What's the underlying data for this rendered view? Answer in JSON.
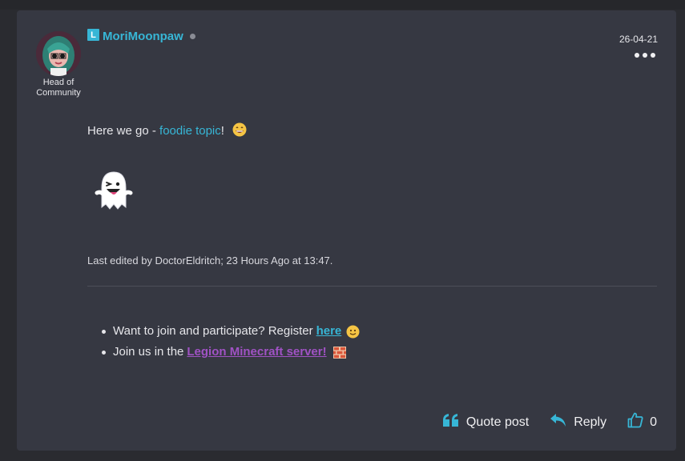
{
  "post": {
    "username": "MoriMoonpaw",
    "badge_letter": "L",
    "role": "Head of Community",
    "date": "26-04-21",
    "body_prefix": "Here we go - ",
    "body_link": "foodie topic",
    "body_suffix": "!",
    "edited_note": "Last edited by DoctorEldritch; 23 Hours Ago at 13:47."
  },
  "signature": {
    "line1_text": "Want to join and participate? Register",
    "line1_link": "here",
    "line2_text": "Join us in the",
    "line2_link": "Legion Minecraft server!"
  },
  "actions": {
    "quote_label": "Quote post",
    "reply_label": "Reply",
    "like_count": "0"
  },
  "colors": {
    "accent": "#37b6d6",
    "minecraft_link": "#a052c4",
    "card_bg": "#363842",
    "page_bg": "#2a2b30"
  },
  "icons": [
    "user-level-badge",
    "status-dot",
    "more-options-icon",
    "grin-emoji",
    "ghost-emoji",
    "smile-emoji",
    "brick-emoji",
    "quote-icon",
    "reply-icon",
    "thumbs-up-icon"
  ]
}
